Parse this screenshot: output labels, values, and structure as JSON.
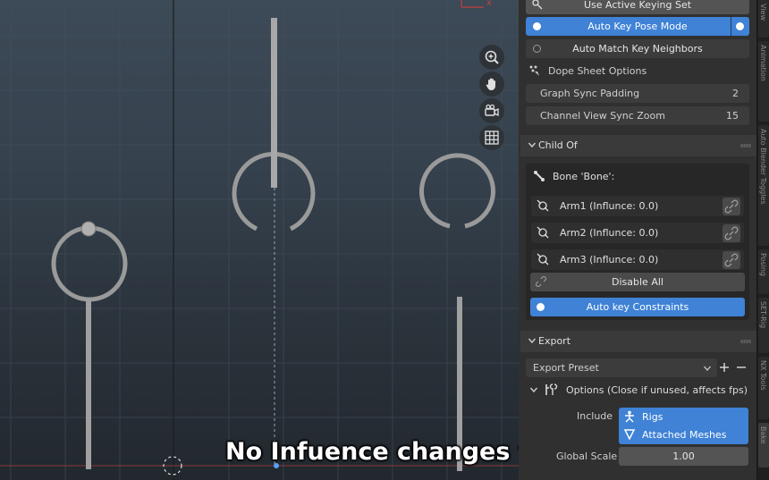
{
  "viewport": {
    "subtitle": "No Infuence changes yet.",
    "axis_label": "x",
    "nav_tools": [
      "zoom-icon",
      "hand-pan-icon",
      "camera-icon",
      "grid-icon"
    ]
  },
  "keying": {
    "use_active_keying_set": "Use Active Keying Set",
    "auto_key_pose_mode": "Auto Key Pose Mode",
    "auto_match_key_neighbors": "Auto Match Key Neighbors",
    "dope_sheet_options": "Dope Sheet Options",
    "graph_sync_padding_label": "Graph Sync Padding",
    "graph_sync_padding_value": "2",
    "channel_view_sync_zoom_label": "Channel View Sync Zoom",
    "channel_view_sync_zoom_value": "15"
  },
  "child_of": {
    "title": "Child Of",
    "bone_label": "Bone 'Bone':",
    "arms": [
      {
        "label": "Arm1 (Influnce: 0.0)"
      },
      {
        "label": "Arm2 (Influnce: 0.0)"
      },
      {
        "label": "Arm3 (Influnce: 0.0)"
      }
    ],
    "disable_all": "Disable All",
    "auto_key_constraints": "Auto key Constraints"
  },
  "export": {
    "title": "Export",
    "preset": "Export Preset",
    "options_label": "Options (Close if unused, affects fps)",
    "include_label": "Include",
    "include_items": [
      "Rigs",
      "Attached Meshes"
    ],
    "global_scale_label": "Global Scale",
    "global_scale_value": "1.00"
  },
  "colors": {
    "accent_blue": "#3f82d6",
    "panel_bg": "#303030",
    "button_bg": "#545454"
  }
}
